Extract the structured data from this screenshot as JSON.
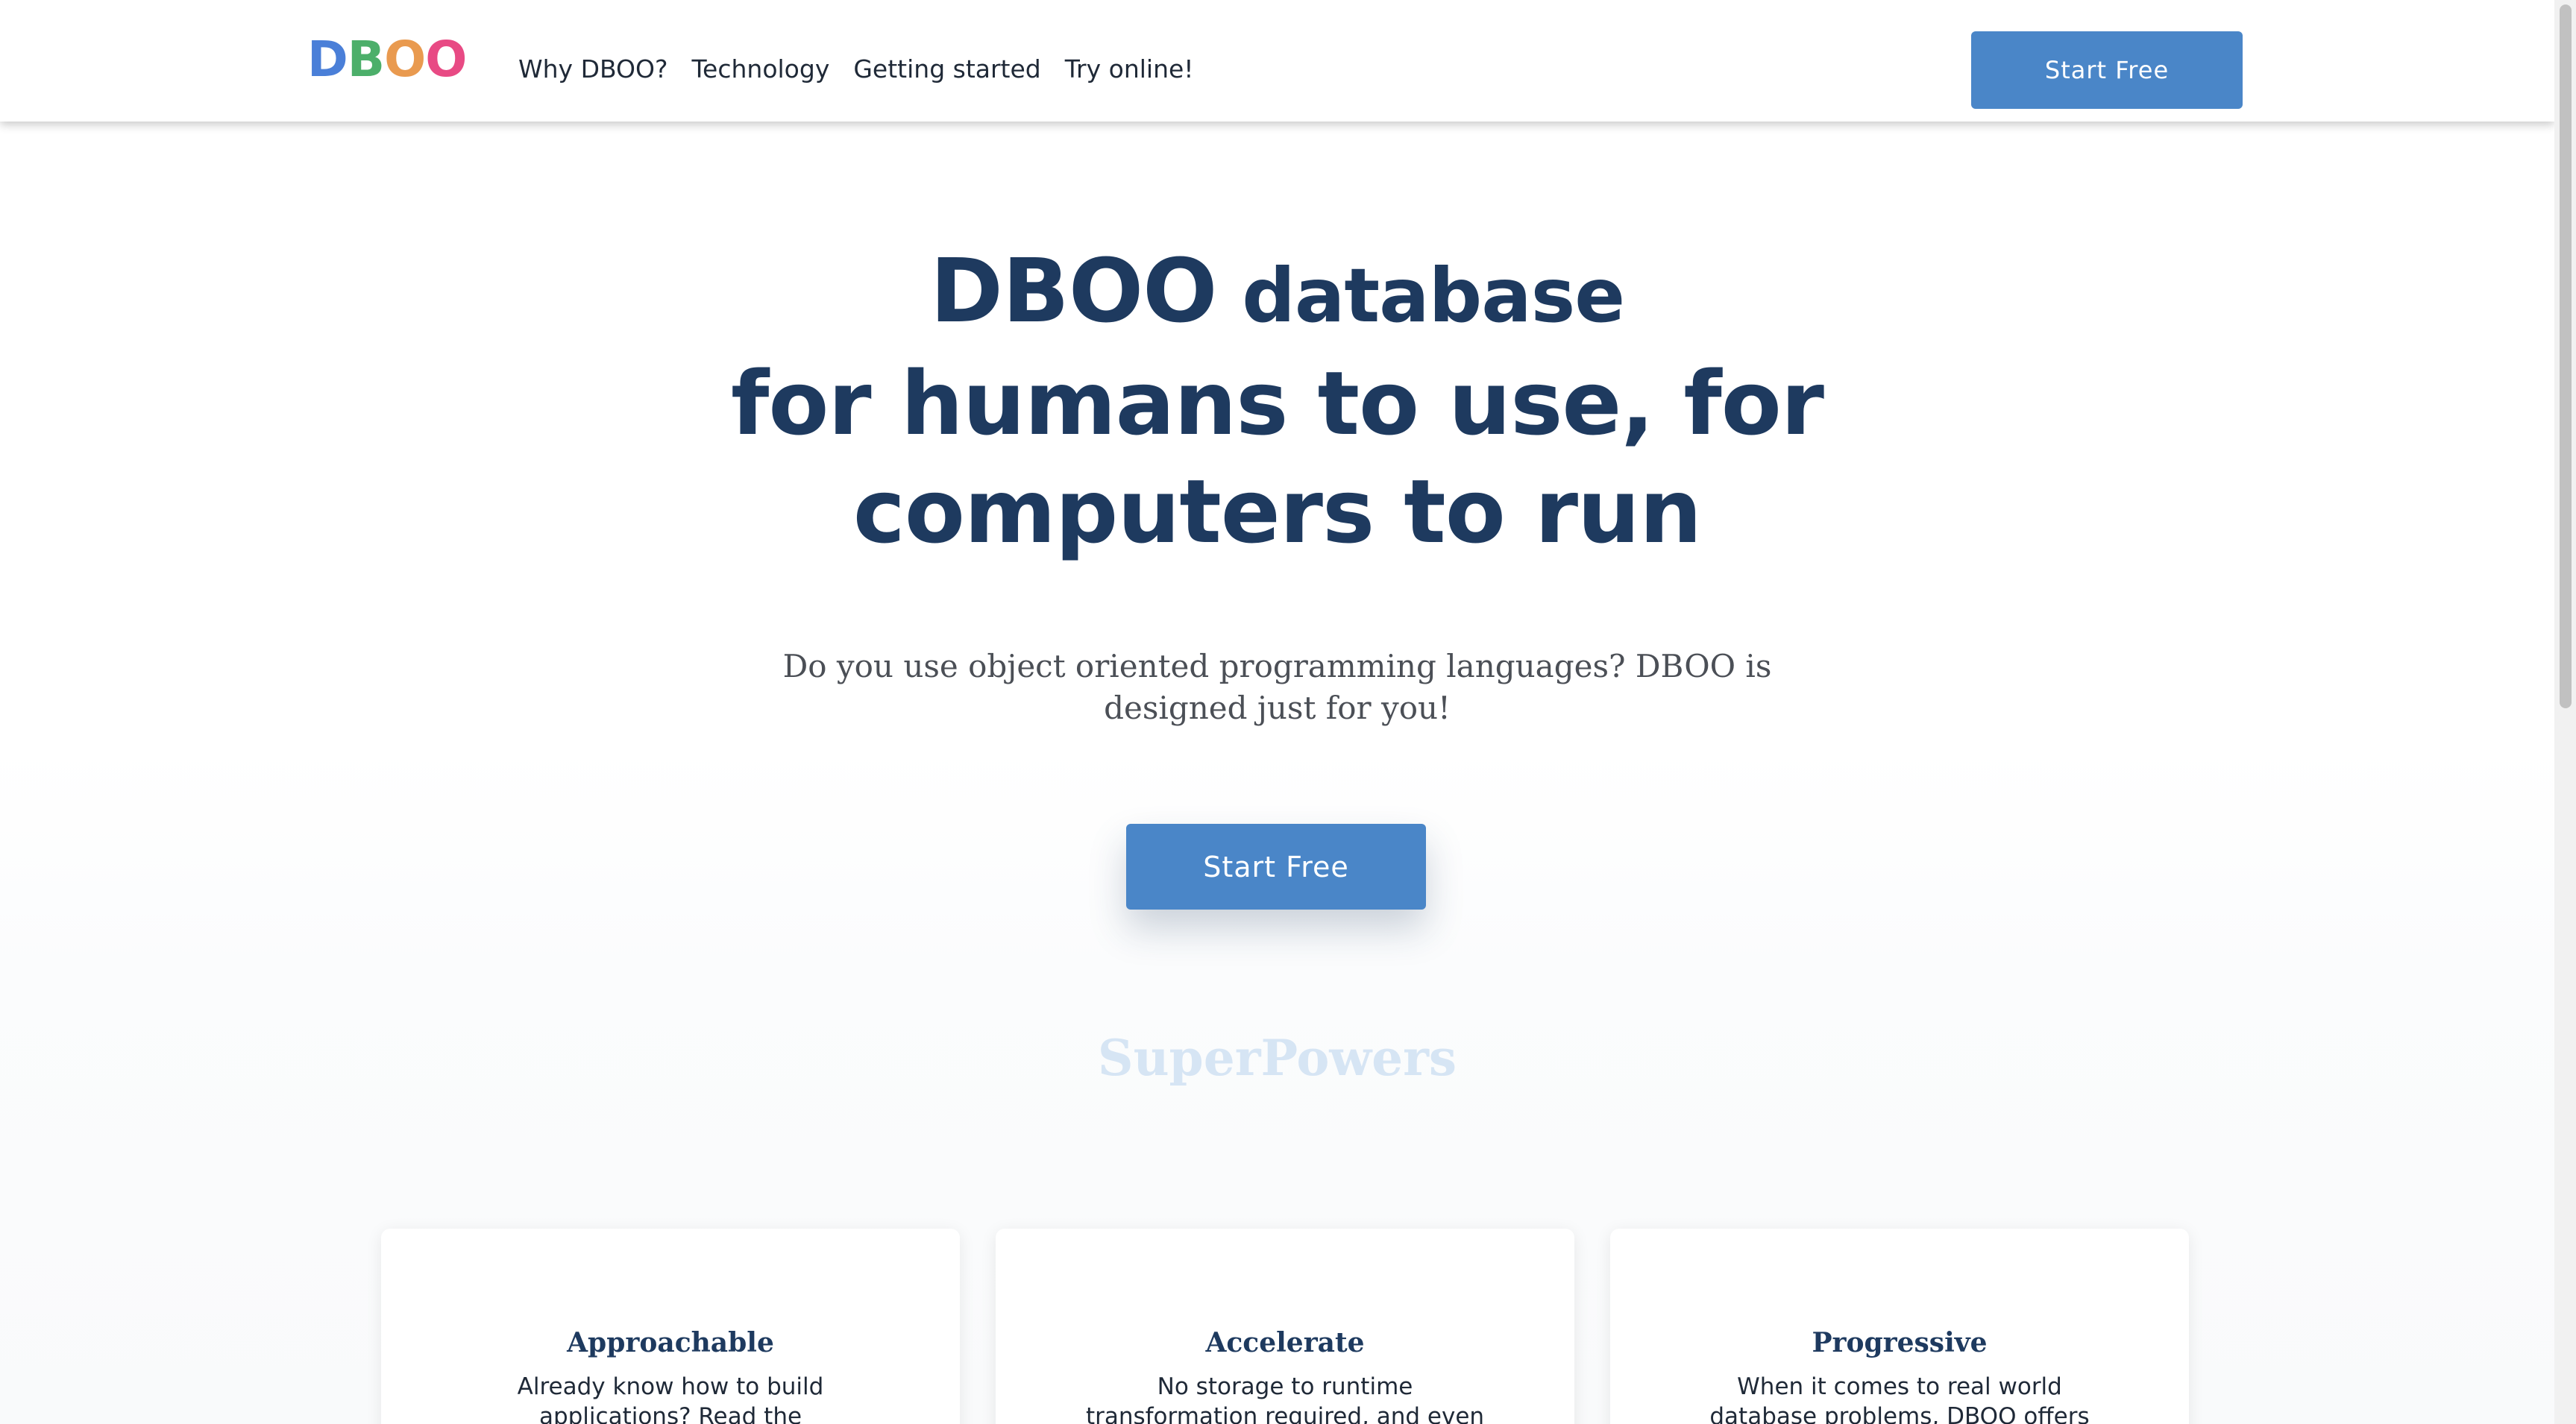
{
  "brand": {
    "logo_letters": [
      {
        "char": "D",
        "color": "#4a7fd8"
      },
      {
        "char": "B",
        "color": "#4caf6a"
      },
      {
        "char": "O",
        "color": "#e99a4f"
      },
      {
        "char": "O",
        "color": "#e84a84"
      }
    ]
  },
  "nav": {
    "items": [
      "Why DBOO?",
      "Technology",
      "Getting started",
      "Try online!"
    ],
    "cta_label": "Start Free"
  },
  "hero": {
    "title_line1_big": "DBOO",
    "title_line1_small": " database",
    "title_line2": "for humans to use, for",
    "title_line3": "computers to run",
    "subtitle": "Do you use object oriented programming languages? DBOO is designed just for you!",
    "cta_label": "Start Free"
  },
  "superpowers": {
    "heading": "SuperPowers",
    "cards": [
      {
        "title": "Approachable",
        "text": "Already know how to build applications? Read the"
      },
      {
        "title": "Accelerate",
        "text": "No storage to runtime transformation required, and even"
      },
      {
        "title": "Progressive",
        "text": "When it comes to real world database problems, DBOO offers the"
      }
    ]
  },
  "colors": {
    "primary": "#4a86c8",
    "heading": "#1e3a5f",
    "section_heading_faded": "#d6e5f4"
  }
}
